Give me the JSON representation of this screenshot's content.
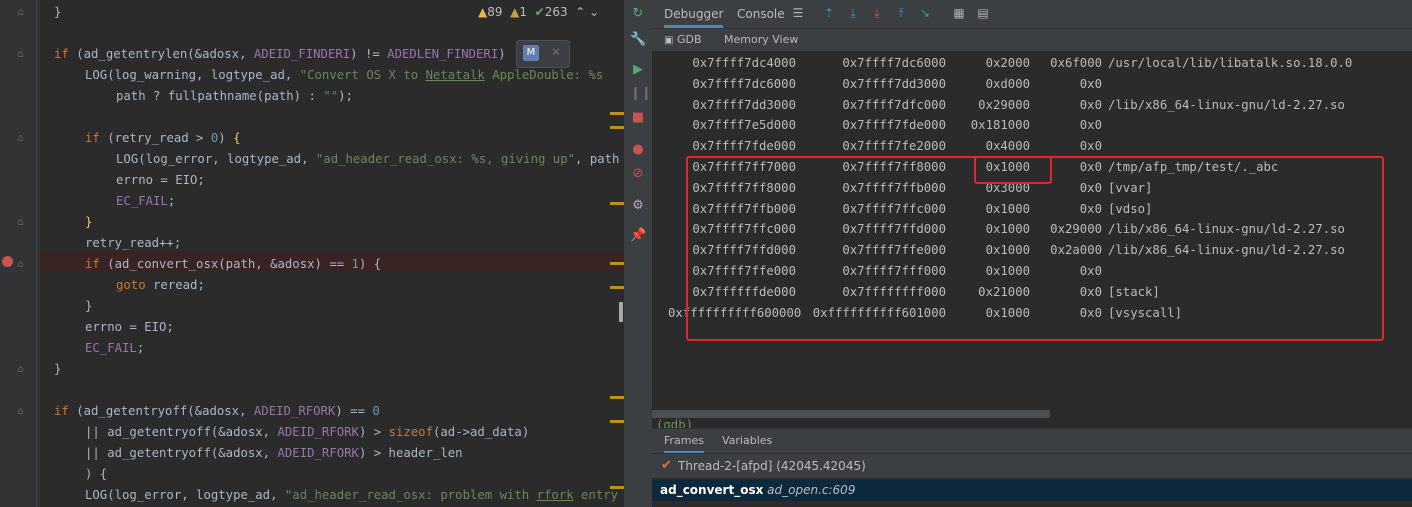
{
  "editor": {
    "inspections": {
      "warnings": "89",
      "weak_warnings": "1",
      "typos": "263"
    },
    "popup_badge": "M",
    "lines": [
      {
        "indent": 0,
        "html_parts": [
          {
            "t": "}",
            "c": ""
          }
        ]
      },
      {
        "indent": 0,
        "html_parts": []
      },
      {
        "indent": 0,
        "html_parts": [
          {
            "t": "if",
            "c": "kw"
          },
          {
            "t": " (ad_getentrylen(&adosx, ",
            "c": ""
          },
          {
            "t": "ADEID_FINDERI",
            "c": "mac"
          },
          {
            "t": ") != ",
            "c": ""
          },
          {
            "t": "ADEDLEN_FINDERI",
            "c": "mac"
          },
          {
            "t": ")",
            "c": ""
          }
        ]
      },
      {
        "indent": 1,
        "html_parts": [
          {
            "t": "LOG(log_warning, logtype_ad, ",
            "c": ""
          },
          {
            "t": "\"Convert OS X to ",
            "c": "str"
          },
          {
            "t": "Netatalk",
            "c": "str under"
          },
          {
            "t": " AppleDouble: %s",
            "c": "str"
          }
        ]
      },
      {
        "indent": 2,
        "html_parts": [
          {
            "t": "path ? fullpathname(path) : ",
            "c": ""
          },
          {
            "t": "\"\"",
            "c": "str"
          },
          {
            "t": ");",
            "c": ""
          }
        ]
      },
      {
        "indent": 0,
        "html_parts": []
      },
      {
        "indent": 1,
        "html_parts": [
          {
            "t": "if",
            "c": "kw"
          },
          {
            "t": " (retry_read > ",
            "c": ""
          },
          {
            "t": "0",
            "c": "num"
          },
          {
            "t": ") ",
            "c": ""
          },
          {
            "t": "{",
            "c": "fn"
          }
        ]
      },
      {
        "indent": 2,
        "html_parts": [
          {
            "t": "LOG(log_error, logtype_ad, ",
            "c": ""
          },
          {
            "t": "\"ad_header_read_osx: %s, giving up\"",
            "c": "str"
          },
          {
            "t": ", path",
            "c": ""
          }
        ]
      },
      {
        "indent": 2,
        "html_parts": [
          {
            "t": "errno = EIO;",
            "c": ""
          }
        ]
      },
      {
        "indent": 2,
        "html_parts": [
          {
            "t": "EC_FAIL",
            "c": "mac"
          },
          {
            "t": ";",
            "c": ""
          }
        ]
      },
      {
        "indent": 1,
        "html_parts": [
          {
            "t": "}",
            "c": "fn"
          }
        ]
      },
      {
        "indent": 1,
        "html_parts": [
          {
            "t": "retry_read++;",
            "c": ""
          }
        ]
      },
      {
        "indent": 1,
        "html_parts": [
          {
            "t": "if",
            "c": "kw"
          },
          {
            "t": " (ad_convert_osx(path, &adosx) == ",
            "c": ""
          },
          {
            "t": "1",
            "c": "num"
          },
          {
            "t": ") {",
            "c": ""
          }
        ]
      },
      {
        "indent": 2,
        "html_parts": [
          {
            "t": "goto",
            "c": "kw"
          },
          {
            "t": " reread;",
            "c": ""
          }
        ]
      },
      {
        "indent": 1,
        "html_parts": [
          {
            "t": "}",
            "c": ""
          }
        ]
      },
      {
        "indent": 1,
        "html_parts": [
          {
            "t": "errno = EIO;",
            "c": ""
          }
        ]
      },
      {
        "indent": 1,
        "html_parts": [
          {
            "t": "EC_FAIL",
            "c": "mac"
          },
          {
            "t": ";",
            "c": ""
          }
        ]
      },
      {
        "indent": 0,
        "html_parts": [
          {
            "t": "}",
            "c": ""
          }
        ]
      },
      {
        "indent": 0,
        "html_parts": []
      },
      {
        "indent": 0,
        "html_parts": [
          {
            "t": "if",
            "c": "kw"
          },
          {
            "t": " (ad_getentryoff(&adosx, ",
            "c": ""
          },
          {
            "t": "ADEID_RFORK",
            "c": "mac"
          },
          {
            "t": ") == ",
            "c": ""
          },
          {
            "t": "0",
            "c": "num"
          }
        ]
      },
      {
        "indent": 1,
        "html_parts": [
          {
            "t": "|| ad_getentryoff(&adosx, ",
            "c": ""
          },
          {
            "t": "ADEID_RFORK",
            "c": "mac"
          },
          {
            "t": ") > ",
            "c": ""
          },
          {
            "t": "sizeof",
            "c": "kw"
          },
          {
            "t": "(ad->ad_data)",
            "c": ""
          }
        ]
      },
      {
        "indent": 1,
        "html_parts": [
          {
            "t": "|| ad_getentryoff(&adosx, ",
            "c": ""
          },
          {
            "t": "ADEID_RFORK",
            "c": "mac"
          },
          {
            "t": ") > header_len",
            "c": ""
          }
        ]
      },
      {
        "indent": 1,
        "html_parts": [
          {
            "t": ") {",
            "c": ""
          }
        ]
      },
      {
        "indent": 1,
        "html_parts": [
          {
            "t": "LOG(log_error, logtype_ad, ",
            "c": ""
          },
          {
            "t": "\"ad_header_read_osx: problem with ",
            "c": "str"
          },
          {
            "t": "rfork",
            "c": "str under"
          },
          {
            "t": " entry",
            "c": "str"
          }
        ]
      }
    ]
  },
  "toolbar": {
    "tab_debugger": "Debugger",
    "tab_console": "Console"
  },
  "subtabs": {
    "gdb": "GDB",
    "memory_view": "Memory View"
  },
  "memory_map": [
    [
      "0x7ffff7dc4000",
      "0x7ffff7dc6000",
      "0x2000",
      "0x6f000",
      "/usr/local/lib/libatalk.so.18.0.0"
    ],
    [
      "0x7ffff7dc6000",
      "0x7ffff7dd3000",
      "0xd000",
      "0x0",
      ""
    ],
    [
      "0x7ffff7dd3000",
      "0x7ffff7dfc000",
      "0x29000",
      "0x0",
      "/lib/x86_64-linux-gnu/ld-2.27.so"
    ],
    [
      "0x7ffff7e5d000",
      "0x7ffff7fde000",
      "0x181000",
      "0x0",
      ""
    ],
    [
      "0x7ffff7fde000",
      "0x7ffff7fe2000",
      "0x4000",
      "0x0",
      ""
    ],
    [
      "0x7ffff7ff7000",
      "0x7ffff7ff8000",
      "0x1000",
      "0x0",
      "/tmp/afp_tmp/test/._abc"
    ],
    [
      "0x7ffff7ff8000",
      "0x7ffff7ffb000",
      "0x3000",
      "0x0",
      "[vvar]"
    ],
    [
      "0x7ffff7ffb000",
      "0x7ffff7ffc000",
      "0x1000",
      "0x0",
      "[vdso]"
    ],
    [
      "0x7ffff7ffc000",
      "0x7ffff7ffd000",
      "0x1000",
      "0x29000",
      "/lib/x86_64-linux-gnu/ld-2.27.so"
    ],
    [
      "0x7ffff7ffd000",
      "0x7ffff7ffe000",
      "0x1000",
      "0x2a000",
      "/lib/x86_64-linux-gnu/ld-2.27.so"
    ],
    [
      "0x7ffff7ffe000",
      "0x7ffff7fff000",
      "0x1000",
      "0x0",
      ""
    ],
    [
      "0x7ffffffde000",
      "0x7ffffffff000",
      "0x21000",
      "0x0",
      "[stack]"
    ],
    [
      "0xffffffffff600000",
      "0xffffffffff601000",
      "0x1000",
      "0x0",
      "[vsyscall]"
    ]
  ],
  "gdb_prompt": "(gdb)",
  "frames": {
    "tab_frames": "Frames",
    "tab_variables": "Variables",
    "thread": "Thread-2-[afpd] (42045.42045)",
    "selected_frame_fn": "ad_convert_osx",
    "selected_frame_loc": "ad_open.c:609"
  },
  "colors": {
    "highlight_box": "#e0272b",
    "accent": "#4a88c7"
  }
}
